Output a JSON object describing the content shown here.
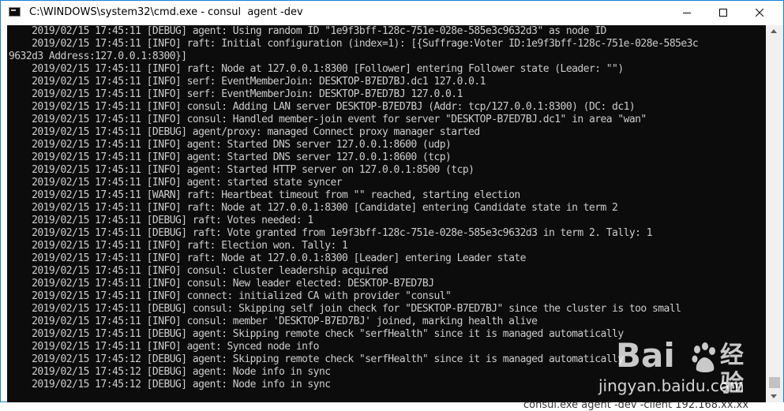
{
  "window": {
    "title": "C:\\WINDOWS\\system32\\cmd.exe - consul  agent -dev",
    "controls": {
      "minimize_icon": "minimize-icon",
      "maximize_icon": "maximize-icon",
      "close_icon": "close-icon"
    }
  },
  "console": {
    "lines": [
      "    2019/02/15 17:45:11 [DEBUG] agent: Using random ID \"1e9f3bff-128c-751e-028e-585e3c9632d3\" as node ID",
      "    2019/02/15 17:45:11 [INFO] raft: Initial configuration (index=1): [{Suffrage:Voter ID:1e9f3bff-128c-751e-028e-585e3c",
      "9632d3 Address:127.0.0.1:8300}]",
      "    2019/02/15 17:45:11 [INFO] raft: Node at 127.0.0.1:8300 [Follower] entering Follower state (Leader: \"\")",
      "    2019/02/15 17:45:11 [INFO] serf: EventMemberJoin: DESKTOP-B7ED7BJ.dc1 127.0.0.1",
      "    2019/02/15 17:45:11 [INFO] serf: EventMemberJoin: DESKTOP-B7ED7BJ 127.0.0.1",
      "    2019/02/15 17:45:11 [INFO] consul: Adding LAN server DESKTOP-B7ED7BJ (Addr: tcp/127.0.0.1:8300) (DC: dc1)",
      "    2019/02/15 17:45:11 [INFO] consul: Handled member-join event for server \"DESKTOP-B7ED7BJ.dc1\" in area \"wan\"",
      "    2019/02/15 17:45:11 [DEBUG] agent/proxy: managed Connect proxy manager started",
      "    2019/02/15 17:45:11 [INFO] agent: Started DNS server 127.0.0.1:8600 (udp)",
      "    2019/02/15 17:45:11 [INFO] agent: Started DNS server 127.0.0.1:8600 (tcp)",
      "    2019/02/15 17:45:11 [INFO] agent: Started HTTP server on 127.0.0.1:8500 (tcp)",
      "    2019/02/15 17:45:11 [INFO] agent: started state syncer",
      "    2019/02/15 17:45:11 [WARN] raft: Heartbeat timeout from \"\" reached, starting election",
      "    2019/02/15 17:45:11 [INFO] raft: Node at 127.0.0.1:8300 [Candidate] entering Candidate state in term 2",
      "    2019/02/15 17:45:11 [DEBUG] raft: Votes needed: 1",
      "    2019/02/15 17:45:11 [DEBUG] raft: Vote granted from 1e9f3bff-128c-751e-028e-585e3c9632d3 in term 2. Tally: 1",
      "    2019/02/15 17:45:11 [INFO] raft: Election won. Tally: 1",
      "    2019/02/15 17:45:11 [INFO] raft: Node at 127.0.0.1:8300 [Leader] entering Leader state",
      "    2019/02/15 17:45:11 [INFO] consul: cluster leadership acquired",
      "    2019/02/15 17:45:11 [INFO] consul: New leader elected: DESKTOP-B7ED7BJ",
      "    2019/02/15 17:45:11 [INFO] connect: initialized CA with provider \"consul\"",
      "    2019/02/15 17:45:11 [DEBUG] consul: Skipping self join check for \"DESKTOP-B7ED7BJ\" since the cluster is too small",
      "    2019/02/15 17:45:11 [INFO] consul: member 'DESKTOP-B7ED7BJ' joined, marking health alive",
      "    2019/02/15 17:45:11 [DEBUG] agent: Skipping remote check \"serfHealth\" since it is managed automatically",
      "    2019/02/15 17:45:11 [INFO] agent: Synced node info",
      "    2019/02/15 17:45:12 [DEBUG] agent: Skipping remote check \"serfHealth\" since it is managed automatically",
      "    2019/02/15 17:45:12 [DEBUG] agent: Node info in sync",
      "    2019/02/15 17:45:12 [DEBUG] agent: Node info in sync"
    ]
  },
  "background_window": {
    "partial_text": "consul.exe agent -dev -client 192.168.xx.xx"
  },
  "watermark": {
    "logo_text": "Bai",
    "logo_icon": "baidu-paw-icon",
    "chinese_text": "经验",
    "url": "jingyan.baidu.com"
  },
  "colors": {
    "console_background": "#0c0c0c",
    "console_text": "#cccccc",
    "window_border": "#1883d7"
  }
}
